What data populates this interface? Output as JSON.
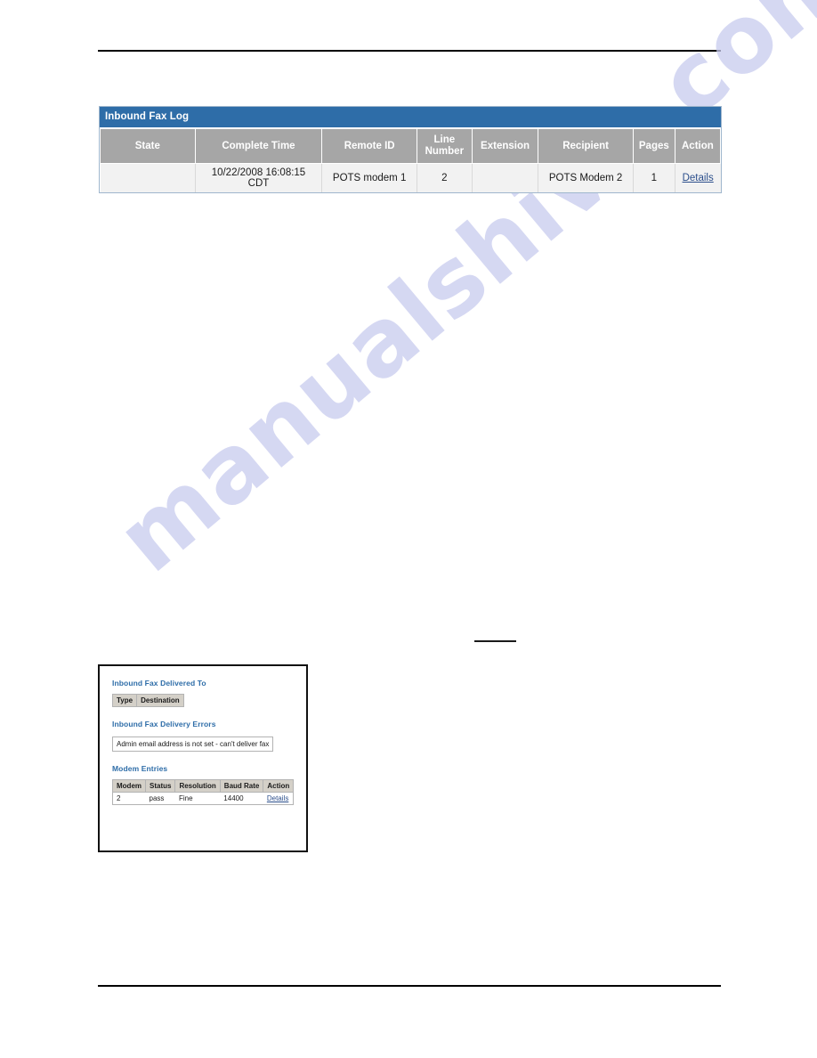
{
  "page": {
    "top_rule": "",
    "bottom_rule": "",
    "watermark": "manualshive.com"
  },
  "fax_log": {
    "title": "Inbound Fax Log",
    "columns": [
      "State",
      "Complete Time",
      "Remote ID",
      "Line Number",
      "Extension",
      "Recipient",
      "Pages",
      "Action"
    ],
    "rows": [
      {
        "state": "",
        "complete_time": "10/22/2008 16:08:15 CDT",
        "remote_id": "POTS modem 1",
        "line_number": "2",
        "extension": "",
        "recipient": "POTS Modem 2",
        "pages": "1",
        "action": "Details"
      }
    ]
  },
  "detail_panel": {
    "delivered_to": {
      "heading": "Inbound Fax Delivered To",
      "columns": [
        "Type",
        "Destination"
      ],
      "rows": []
    },
    "delivery_errors": {
      "heading": "Inbound Fax Delivery Errors",
      "messages": [
        "Admin email address is not set - can't deliver fax"
      ]
    },
    "modem_entries": {
      "heading": "Modem Entries",
      "columns": [
        "Modem",
        "Status",
        "Resolution",
        "Baud Rate",
        "Action"
      ],
      "rows": [
        {
          "modem": "2",
          "status": "pass",
          "resolution": "Fine",
          "baud_rate": "14400",
          "action": "Details"
        }
      ]
    }
  },
  "colors": {
    "title_bar": "#2e6da8",
    "header_cell": "#a6a6a6",
    "row_bg": "#f2f2f2",
    "link": "#2c4f8c",
    "heading_blue": "#2e6da8",
    "watermark": "#c8cbee"
  }
}
